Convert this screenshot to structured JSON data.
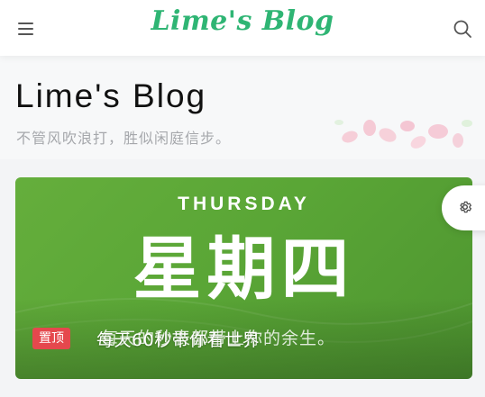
{
  "topbar": {
    "brand": "Lime's Blog",
    "menu_icon": "hamburger-menu-icon",
    "search_icon": "search-icon"
  },
  "header": {
    "title": "Lime's Blog",
    "subtitle": "不管风吹浪打，胜似闲庭信步。"
  },
  "featured": {
    "image_day_en": "THURSDAY",
    "image_day_cn": "星期四",
    "image_quote": "每天的秒表都带上你的余生。",
    "pin_label": "置顶",
    "title": "每天60秒带你看世界"
  },
  "floating": {
    "settings_icon": "gear-icon"
  },
  "colors": {
    "brand": "#2fb574",
    "card_green": "#5aa636",
    "pin_red": "#e5484d"
  }
}
